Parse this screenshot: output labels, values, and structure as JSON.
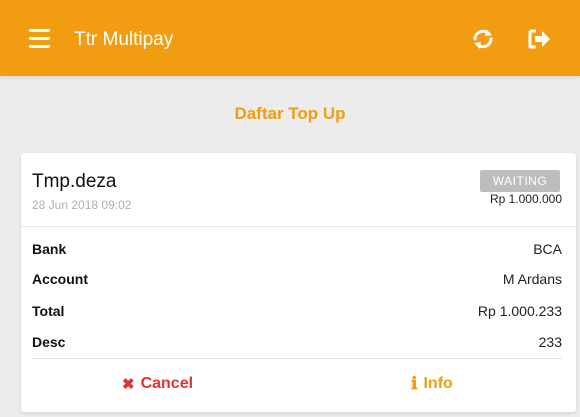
{
  "app": {
    "title": "Ttr Multipay"
  },
  "header": {
    "page_title": "Daftar Top Up"
  },
  "card": {
    "name": "Tmp.deza",
    "date": "28 Jun 2018 09:02",
    "status": "WAITING",
    "amount": "Rp 1.000.000",
    "rows": [
      {
        "label": "Bank",
        "value": "BCA"
      },
      {
        "label": "Account",
        "value": "M Ardans"
      },
      {
        "label": "Total",
        "value": "Rp 1.000.233"
      },
      {
        "label": "Desc",
        "value": "233"
      }
    ],
    "actions": {
      "cancel": "Cancel",
      "info": "Info"
    }
  },
  "colors": {
    "primary": "#f29c12",
    "danger": "#e03232",
    "badge": "#bdbdbd",
    "background": "#ececec"
  },
  "icons": {
    "menu": "hamburger-icon",
    "refresh": "refresh-icon",
    "logout": "logout-icon",
    "cancel": "x-icon",
    "info": "info-icon"
  }
}
